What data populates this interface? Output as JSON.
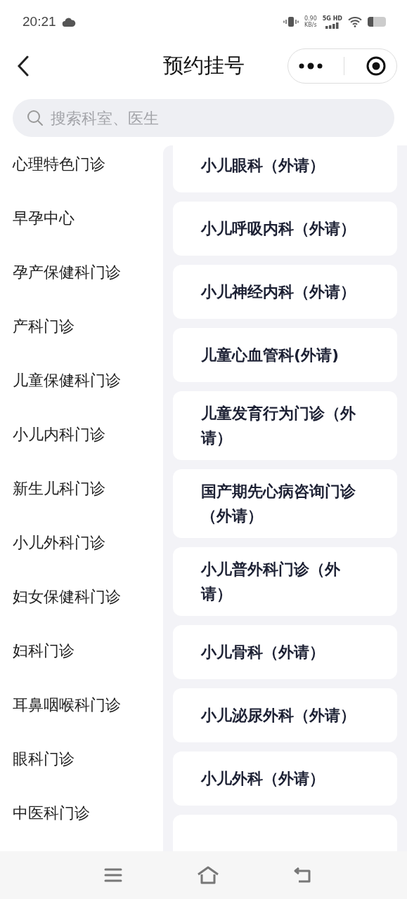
{
  "status_bar": {
    "time": "20:21",
    "speed_value": "0.90",
    "speed_unit": "KB/s",
    "network": "5G HD"
  },
  "header": {
    "title": "预约挂号"
  },
  "search": {
    "placeholder": "搜索科室、医生"
  },
  "departments": [
    {
      "label": "心理特色门诊",
      "selected": false
    },
    {
      "label": "早孕中心",
      "selected": false
    },
    {
      "label": "孕产保健科门诊",
      "selected": false
    },
    {
      "label": "产科门诊",
      "selected": false
    },
    {
      "label": "儿童保健科门诊",
      "selected": false
    },
    {
      "label": "小儿内科门诊",
      "selected": false
    },
    {
      "label": "新生儿科门诊",
      "selected": false
    },
    {
      "label": "小儿外科门诊",
      "selected": false
    },
    {
      "label": "妇女保健科门诊",
      "selected": false
    },
    {
      "label": "妇科门诊",
      "selected": false
    },
    {
      "label": "耳鼻咽喉科门诊",
      "selected": false
    },
    {
      "label": "眼科门诊",
      "selected": false
    },
    {
      "label": "中医科门诊",
      "selected": false
    }
  ],
  "clinics": [
    "小儿眼科（外请）",
    "小儿呼吸内科（外请）",
    "小儿神经内科（外请）",
    "儿童心血管科(外请)",
    "儿童发育行为门诊（外请）",
    "国产期先心病咨询门诊（外请）",
    "小儿普外科门诊（外请）",
    "小儿骨科（外请）",
    "小儿泌尿外科（外请）",
    "小儿外科（外请）"
  ]
}
